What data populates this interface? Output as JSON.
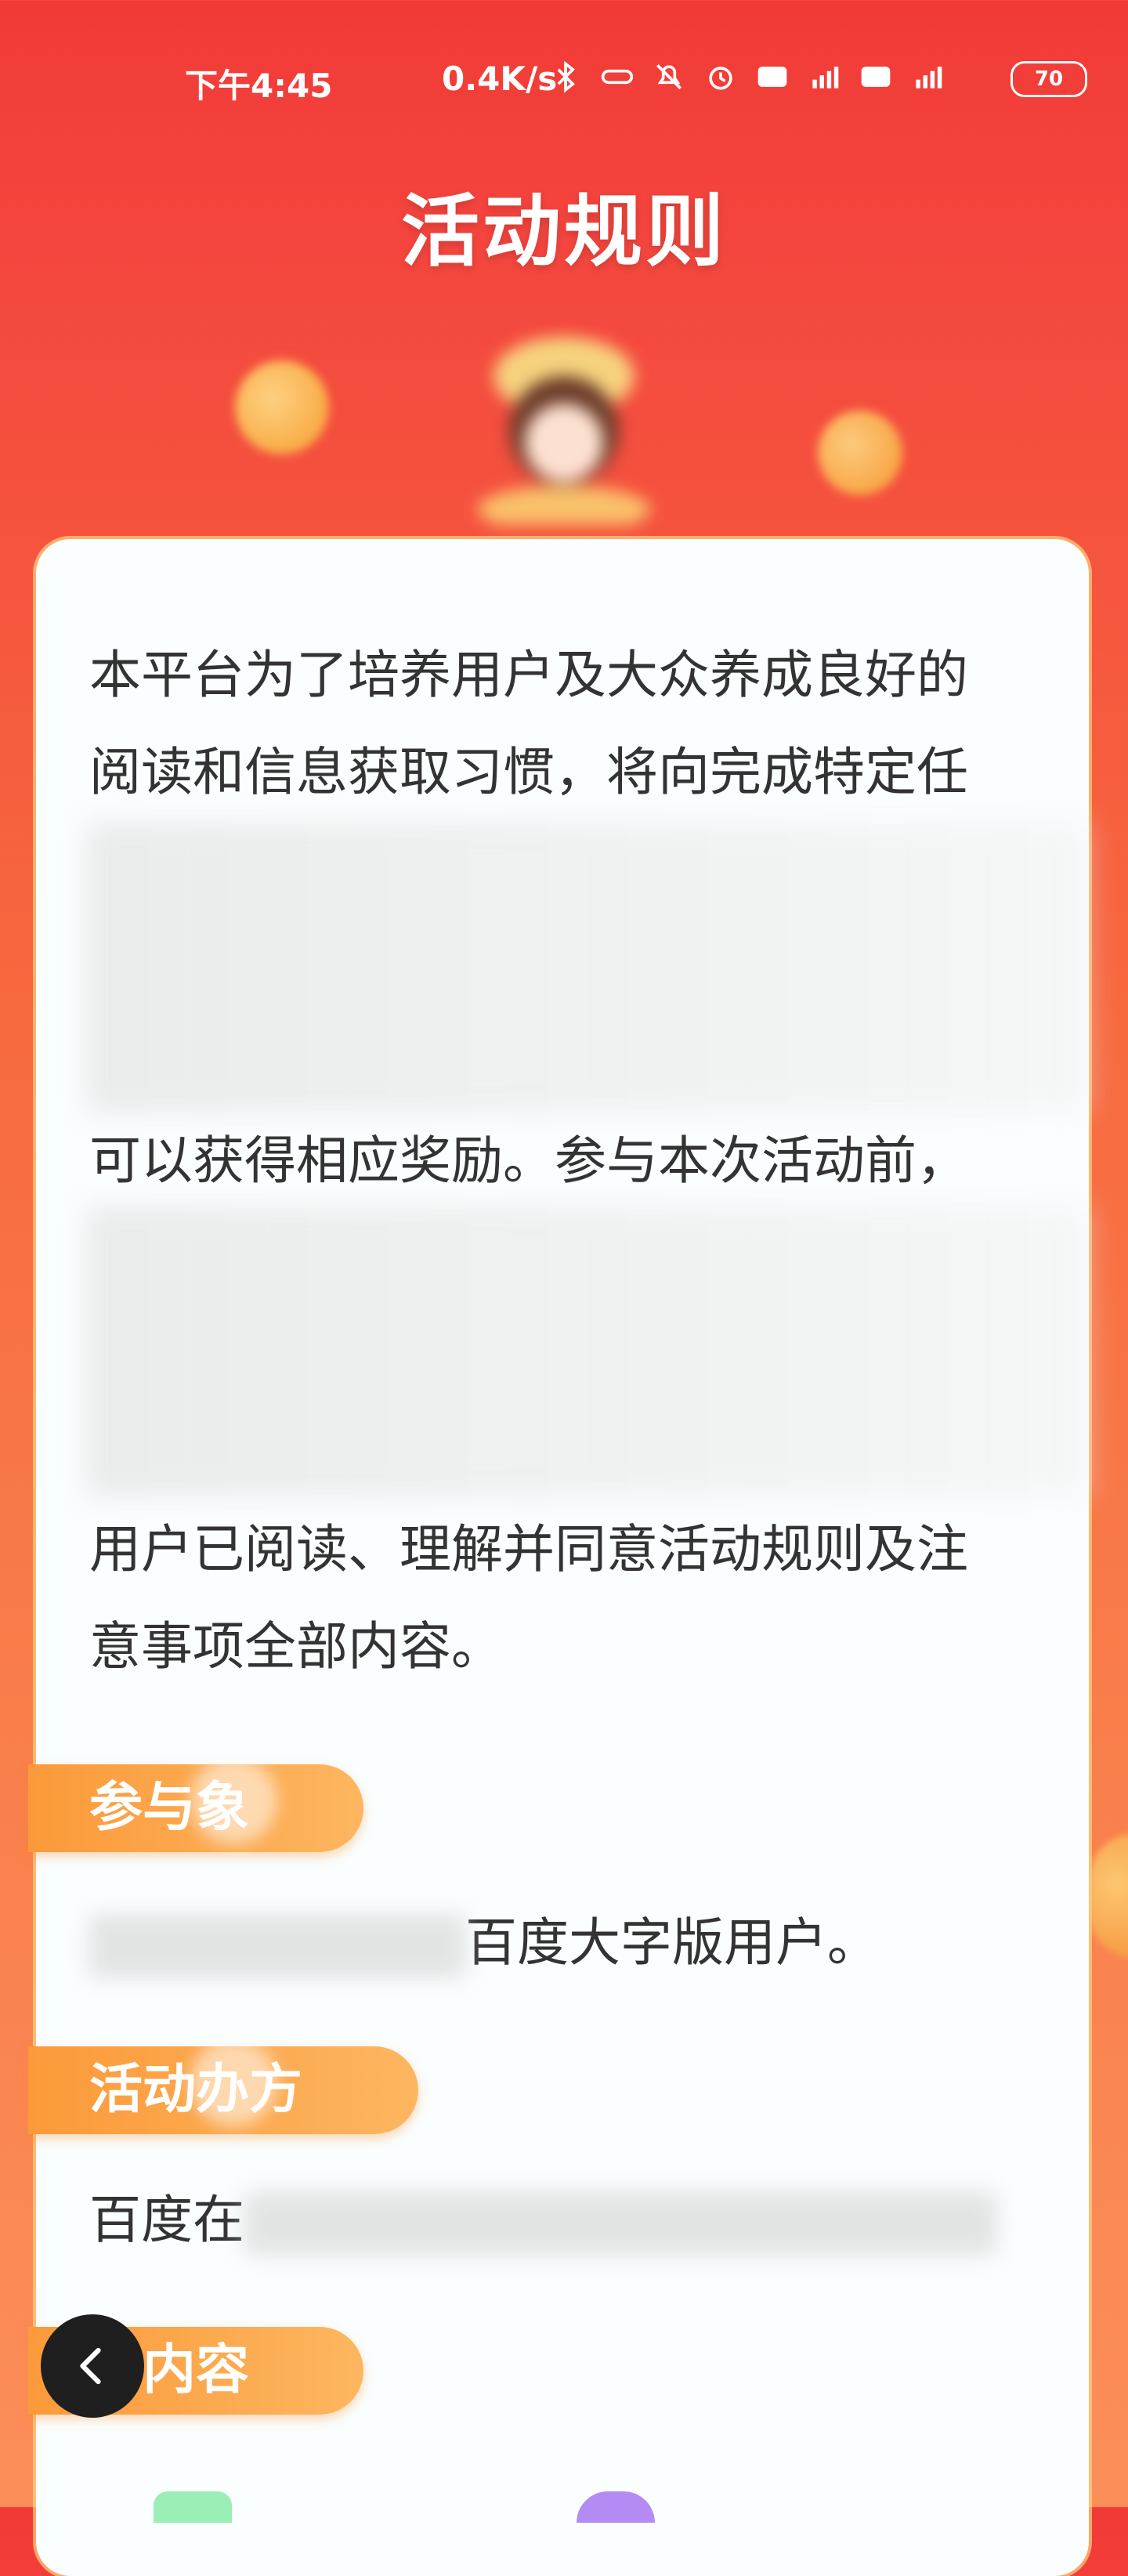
{
  "status_bar": {
    "time": "下午4:45",
    "network_speed": "0.4K/s",
    "battery": "70",
    "icons": [
      "bluetooth-icon",
      "link-icon",
      "mute-icon",
      "alarm-icon",
      "hd-icon",
      "signal-4g-icon",
      "hd-icon",
      "signal-5g-icon"
    ]
  },
  "header": {
    "title": "活动规则"
  },
  "intro": {
    "lines": [
      "本平台为了培养用户及大众养成良好的",
      "阅读和信息获取习惯，将向完成特定任",
      "",
      "",
      "",
      "可以获得相应奖励。参与本次活动前，",
      "",
      "",
      "",
      "用户已阅读、理解并同意活动规则及注",
      "意事项全部内容。"
    ]
  },
  "sections": [
    {
      "label_start": "参与",
      "label_end": "象",
      "text": "百度大字版用户。"
    },
    {
      "label_start": "活动",
      "label_end": "办方",
      "text": "百度在"
    },
    {
      "label_start": "",
      "label_end": "动内容",
      "text": ""
    }
  ],
  "colors": {
    "background_top": "#f13a36",
    "background_bottom": "#fb8f5a",
    "card": "#fafefe",
    "pill": "#fb9a3a",
    "text": "#333333"
  },
  "back_button": {
    "icon": "chevron-left-icon"
  }
}
